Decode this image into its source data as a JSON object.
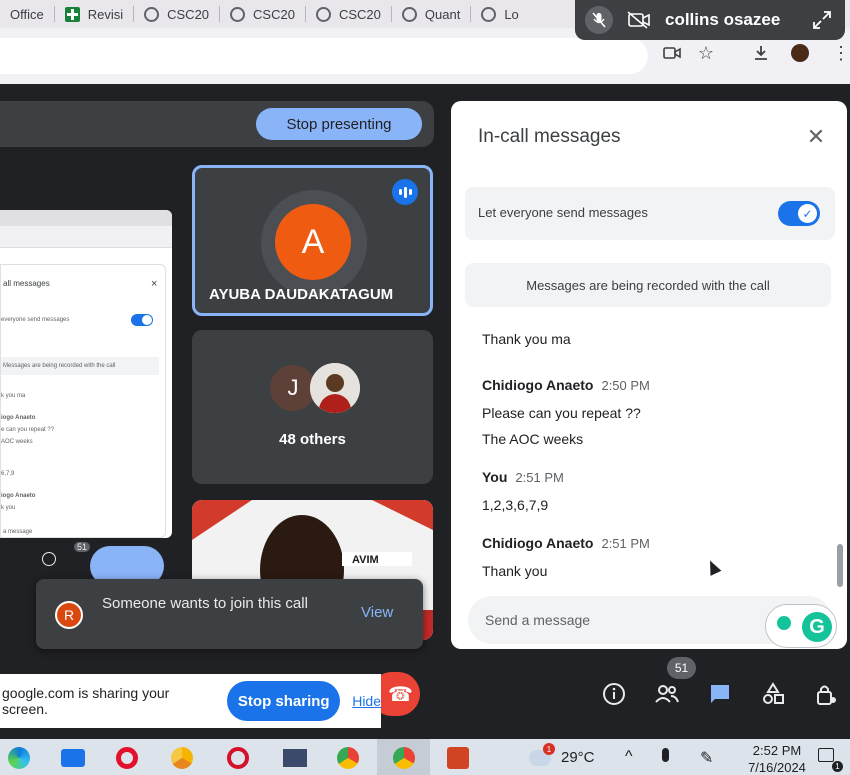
{
  "browser": {
    "tabs": [
      {
        "label": "Office",
        "icon": "office-icon"
      },
      {
        "label": "Revisi",
        "icon": "sheets-icon"
      },
      {
        "label": "CSC20",
        "icon": "globe-icon"
      },
      {
        "label": "CSC20",
        "icon": "globe-icon"
      },
      {
        "label": "CSC20",
        "icon": "globe-icon"
      },
      {
        "label": "Quant",
        "icon": "globe-icon"
      },
      {
        "label": "Lo",
        "icon": "globe-icon"
      }
    ]
  },
  "share_pill": {
    "name": "collins osazee"
  },
  "meet": {
    "stop_presenting": "Stop presenting",
    "speaker": {
      "initial": "A",
      "name": "AYUBA DAUDAKATAGUM"
    },
    "others": {
      "initial": "J",
      "label": "48 others"
    },
    "mini_preview": {
      "title": "all messages",
      "setting": "everyone send messages",
      "recording": "Messages are being recorded with the call",
      "lines": [
        "k you ma",
        "iogo Anaeto",
        "e can you repeat ??",
        "AOC weeks",
        "6,7,9",
        "iogo Anaeto",
        "k you",
        "a message"
      ],
      "count": "51"
    },
    "toast": {
      "initial": "R",
      "message": "Someone wants to join this call",
      "action": "View"
    },
    "participants_badge": "51"
  },
  "chat": {
    "title": "In-call messages",
    "setting_label": "Let everyone send messages",
    "setting_on": true,
    "recording_notice": "Messages are being recorded with the call",
    "messages": [
      {
        "sender": "",
        "time": "",
        "lines": [
          "Thank you ma"
        ]
      },
      {
        "sender": "Chidiogo Anaeto",
        "time": "2:50 PM",
        "lines": [
          "Please can you repeat ??",
          "The AOC weeks"
        ]
      },
      {
        "sender": "You",
        "time": "2:51 PM",
        "lines": [
          "1,2,3,6,7,9"
        ]
      },
      {
        "sender": "Chidiogo Anaeto",
        "time": "2:51 PM",
        "lines": [
          "Thank you"
        ]
      }
    ],
    "input_placeholder": "Send a message"
  },
  "sharing_bar": {
    "text": "google.com is sharing your screen.",
    "stop_label": "Stop sharing",
    "hide_label": "Hide"
  },
  "taskbar": {
    "temperature": "29°C",
    "time": "2:52 PM",
    "date": "7/16/2024",
    "weather_badge": "1",
    "notification_badge": "1"
  },
  "colors": {
    "accent": "#1a73e8",
    "meet_bg": "#202124",
    "toast_bg": "#3c4043",
    "end_call": "#ea4335"
  }
}
